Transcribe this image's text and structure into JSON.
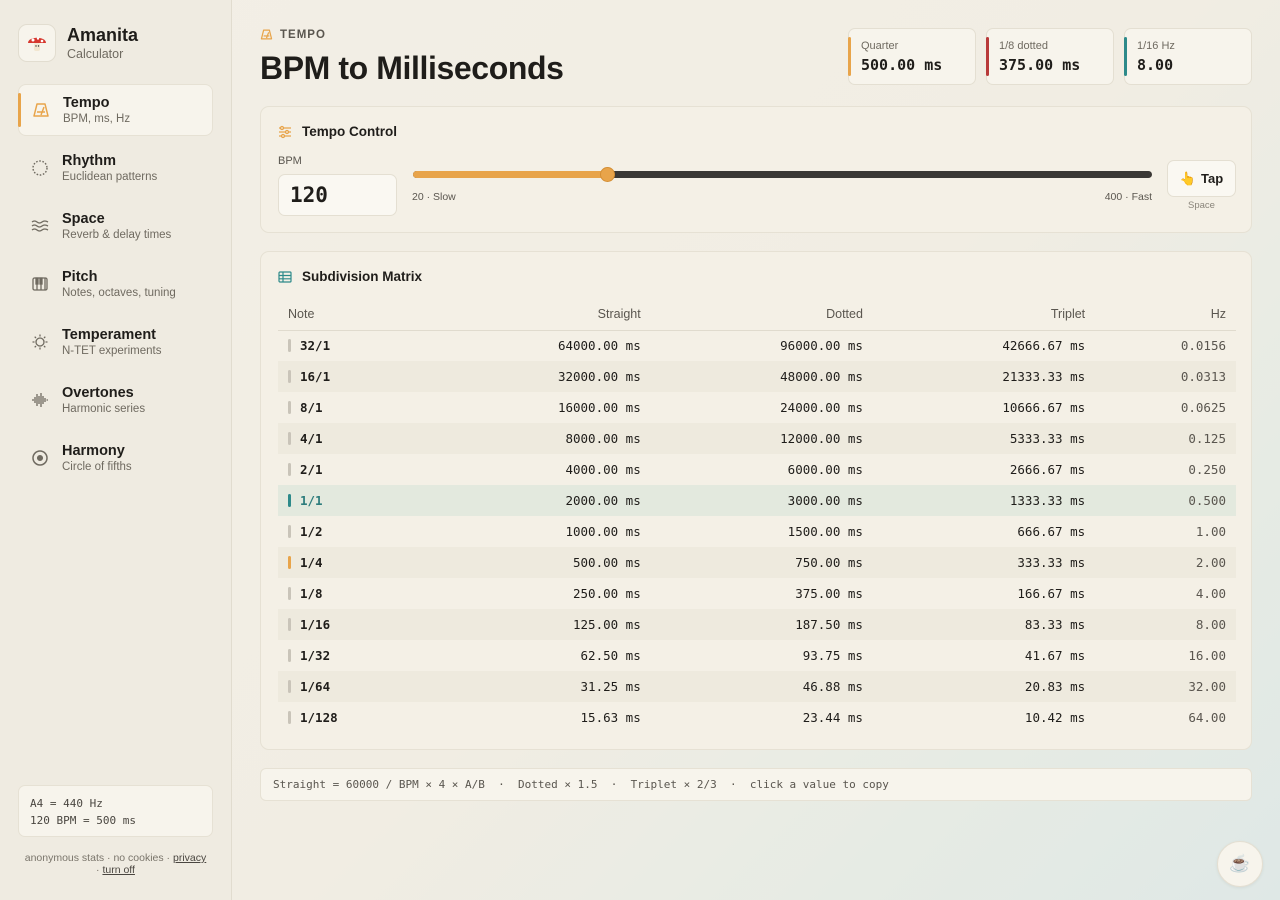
{
  "brand": {
    "title": "Amanita",
    "subtitle": "Calculator"
  },
  "nav": [
    {
      "label": "Tempo",
      "desc": "BPM, ms, Hz",
      "icon": "metronome-icon",
      "active": true
    },
    {
      "label": "Rhythm",
      "desc": "Euclidean patterns",
      "icon": "dotted-circle-icon"
    },
    {
      "label": "Space",
      "desc": "Reverb & delay times",
      "icon": "waves-icon"
    },
    {
      "label": "Pitch",
      "desc": "Notes, octaves, tuning",
      "icon": "piano-icon"
    },
    {
      "label": "Temperament",
      "desc": "N-TET experiments",
      "icon": "tuning-sun-icon"
    },
    {
      "label": "Overtones",
      "desc": "Harmonic series",
      "icon": "waveform-icon"
    },
    {
      "label": "Harmony",
      "desc": "Circle of fifths",
      "icon": "target-circle-icon"
    }
  ],
  "reference": {
    "line1": "A4 = 440 Hz",
    "line2": "120 BPM = 500 ms"
  },
  "footer": {
    "text": "anonymous stats · no cookies ·",
    "privacy": "privacy",
    "sep": "·",
    "turn_off": "turn off"
  },
  "header": {
    "kicker": "TEMPO",
    "title": "BPM to Milliseconds"
  },
  "stats": [
    {
      "label": "Quarter",
      "value": "500.00 ms",
      "accent": "#e8a44a"
    },
    {
      "label": "1/8 dotted",
      "value": "375.00 ms",
      "accent": "#b83a3a"
    },
    {
      "label": "1/16 Hz",
      "value": "8.00",
      "accent": "#2d8a8a"
    }
  ],
  "tempo": {
    "title": "Tempo Control",
    "bpm_label": "BPM",
    "bpm_value": "120",
    "slider_min_label": "20 · Slow",
    "slider_max_label": "400 · Fast",
    "slider_min": 20,
    "slider_max": 400,
    "tap_label": "Tap",
    "tap_hint": "Space"
  },
  "matrix": {
    "title": "Subdivision Matrix",
    "headers": [
      "Note",
      "Straight",
      "Dotted",
      "Triplet",
      "Hz"
    ],
    "rows": [
      {
        "note": "32/1",
        "straight": "64000.00 ms",
        "dotted": "96000.00 ms",
        "triplet": "42666.67 ms",
        "hz": "0.0156"
      },
      {
        "note": "16/1",
        "straight": "32000.00 ms",
        "dotted": "48000.00 ms",
        "triplet": "21333.33 ms",
        "hz": "0.0313"
      },
      {
        "note": "8/1",
        "straight": "16000.00 ms",
        "dotted": "24000.00 ms",
        "triplet": "10666.67 ms",
        "hz": "0.0625"
      },
      {
        "note": "4/1",
        "straight": "8000.00 ms",
        "dotted": "12000.00 ms",
        "triplet": "5333.33 ms",
        "hz": "0.125"
      },
      {
        "note": "2/1",
        "straight": "4000.00 ms",
        "dotted": "6000.00 ms",
        "triplet": "2666.67 ms",
        "hz": "0.250"
      },
      {
        "note": "1/1",
        "straight": "2000.00 ms",
        "dotted": "3000.00 ms",
        "triplet": "1333.33 ms",
        "hz": "0.500",
        "highlight": true,
        "marker": "#2d8a8a"
      },
      {
        "note": "1/2",
        "straight": "1000.00 ms",
        "dotted": "1500.00 ms",
        "triplet": "666.67 ms",
        "hz": "1.00"
      },
      {
        "note": "1/4",
        "straight": "500.00 ms",
        "dotted": "750.00 ms",
        "triplet": "333.33 ms",
        "hz": "2.00",
        "marker": "#e8a44a"
      },
      {
        "note": "1/8",
        "straight": "250.00 ms",
        "dotted": "375.00 ms",
        "triplet": "166.67 ms",
        "hz": "4.00"
      },
      {
        "note": "1/16",
        "straight": "125.00 ms",
        "dotted": "187.50 ms",
        "triplet": "83.33 ms",
        "hz": "8.00"
      },
      {
        "note": "1/32",
        "straight": "62.50 ms",
        "dotted": "93.75 ms",
        "triplet": "41.67 ms",
        "hz": "16.00"
      },
      {
        "note": "1/64",
        "straight": "31.25 ms",
        "dotted": "46.88 ms",
        "triplet": "20.83 ms",
        "hz": "32.00"
      },
      {
        "note": "1/128",
        "straight": "15.63 ms",
        "dotted": "23.44 ms",
        "triplet": "10.42 ms",
        "hz": "64.00"
      }
    ]
  },
  "formula": "Straight = 60000 / BPM × 4 × A/B  ·  Dotted × 1.5  ·  Triplet × 2/3  ·  click a value to copy",
  "colors": {
    "accent": "#e8a44a",
    "teal": "#2d8a8a",
    "red": "#b83a3a"
  },
  "coffee_icon": "coffee-cup-icon"
}
